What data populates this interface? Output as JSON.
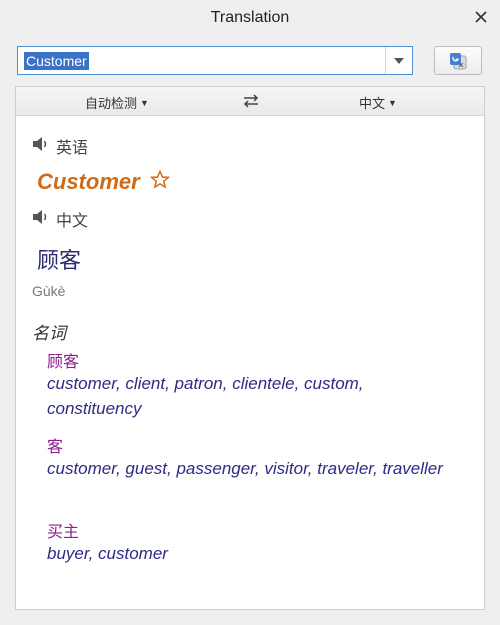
{
  "window": {
    "title": "Translation"
  },
  "search": {
    "value": "Customer"
  },
  "lang_bar": {
    "source": "自动检测",
    "target": "中文"
  },
  "source": {
    "language": "英语",
    "word": "Customer"
  },
  "target": {
    "language": "中文",
    "word": "顾客",
    "pinyin": "Gùkè"
  },
  "part_of_speech": "名词",
  "senses": [
    {
      "term": "顾客",
      "synonyms": "customer, client, patron, clientele, custom, constituency"
    },
    {
      "term": "客",
      "synonyms": "customer, guest, passenger, visitor, traveler, traveller"
    },
    {
      "term": "买主",
      "synonyms": "buyer, customer"
    }
  ],
  "colors": {
    "accent": "#3a73c6",
    "headword": "#d06a14",
    "sense_term": "#8b1e8b",
    "synonyms": "#2e2a86"
  },
  "icons": [
    "close-icon",
    "dropdown-arrow-icon",
    "translate-icon",
    "swap-icon",
    "speaker-icon",
    "favorite-star-icon"
  ]
}
